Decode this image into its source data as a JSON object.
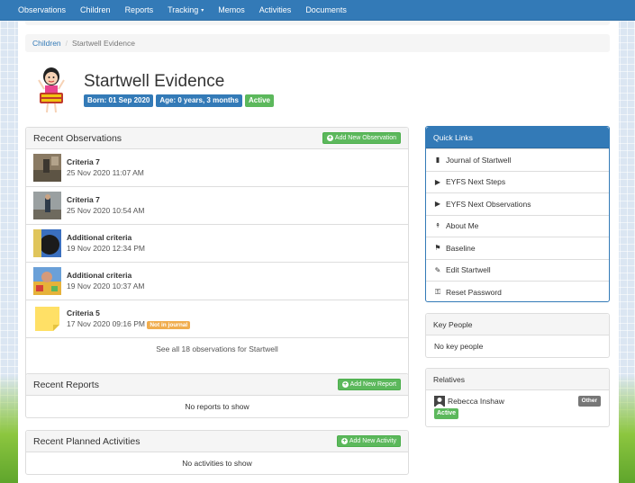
{
  "nav": {
    "items": [
      "Observations",
      "Children",
      "Reports",
      "Tracking",
      "Memos",
      "Activities",
      "Documents"
    ],
    "dropdown_caret": "▾"
  },
  "breadcrumb": {
    "home": "Children",
    "separator": "/",
    "current": "Startwell Evidence"
  },
  "child": {
    "name": "Startwell Evidence",
    "born": "Born: 01 Sep 2020",
    "age": "Age: 0 years, 3 months",
    "status": "Active"
  },
  "recent_observations": {
    "heading": "Recent Observations",
    "add_label": "Add New Observation",
    "items": [
      {
        "title": "Criteria 7",
        "date": "25 Nov 2020 11:07 AM",
        "thumb": "photo-outdoor"
      },
      {
        "title": "Criteria 7",
        "date": "25 Nov 2020 10:54 AM",
        "thumb": "photo-outdoor"
      },
      {
        "title": "Additional criteria",
        "date": "19 Nov 2020 12:34 PM",
        "thumb": "photo-child"
      },
      {
        "title": "Additional criteria",
        "date": "19 Nov 2020 10:37 AM",
        "thumb": "photo-toys"
      },
      {
        "title": "Criteria 5",
        "date": "17 Nov 2020 09:16 PM",
        "thumb": "sticky-note",
        "badge": "Not in journal"
      }
    ],
    "see_all": "See all 18 observations for Startwell"
  },
  "recent_reports": {
    "heading": "Recent Reports",
    "add_label": "Add New Report",
    "empty": "No reports to show"
  },
  "recent_activities": {
    "heading": "Recent Planned Activities",
    "add_label": "Add New Activity",
    "empty": "No activities to show"
  },
  "quick_links": {
    "heading": "Quick Links",
    "items": [
      {
        "label": "Journal of Startwell",
        "icon": "book-icon",
        "glyph": "▮"
      },
      {
        "label": "EYFS Next Steps",
        "icon": "step-forward-icon",
        "glyph": "▶"
      },
      {
        "label": "EYFS Next Observations",
        "icon": "step-forward-icon",
        "glyph": "▶"
      },
      {
        "label": "About Me",
        "icon": "pushpin-icon",
        "glyph": "📌"
      },
      {
        "label": "Baseline",
        "icon": "flag-icon",
        "glyph": "⚑"
      },
      {
        "label": "Edit Startwell",
        "icon": "pencil-icon",
        "glyph": "✎"
      },
      {
        "label": "Reset Password",
        "icon": "key-icon",
        "glyph": "⚿"
      }
    ]
  },
  "key_people": {
    "heading": "Key People",
    "empty": "No key people"
  },
  "relatives": {
    "heading": "Relatives",
    "items": [
      {
        "name": "Rebecca Inshaw",
        "role": "Other",
        "status": "Active"
      }
    ]
  },
  "colors": {
    "primary": "#337ab7",
    "success": "#5cb85c",
    "warning": "#f0ad4e",
    "muted": "#777777"
  }
}
